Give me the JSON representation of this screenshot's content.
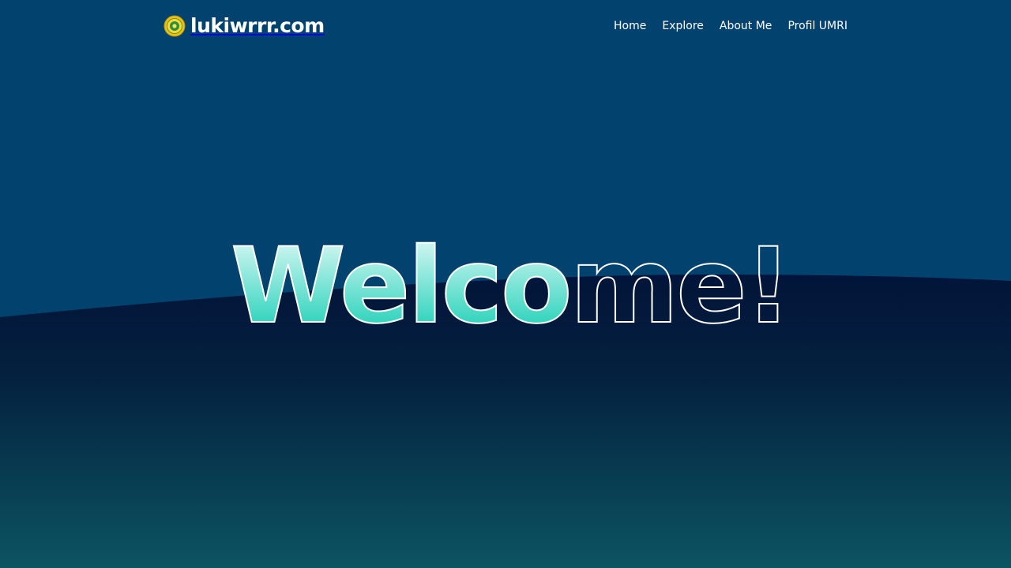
{
  "site": {
    "brand": "lukiwrrr.com",
    "logo_icon": "university-emblem-icon"
  },
  "nav": {
    "items": [
      {
        "label": "Home"
      },
      {
        "label": "Explore"
      },
      {
        "label": "About Me"
      },
      {
        "label": "Profil UMRI"
      }
    ]
  },
  "hero": {
    "headline_filled": "Welco",
    "headline_outline": "me!"
  },
  "colors": {
    "top_bg": "#02426e",
    "bottom_bg_start": "#02163d",
    "bottom_bg_end": "#0a4f60",
    "accent_top": "#d6f7f3",
    "accent_bottom": "#34d5bf",
    "outline": "#ffffff"
  }
}
